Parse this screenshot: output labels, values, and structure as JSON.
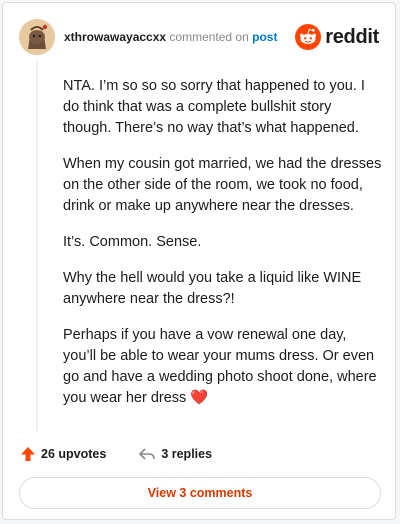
{
  "header": {
    "username": "xthrowawayaccxx",
    "commented_on": "commented on",
    "post_label": "post",
    "logo_text": "reddit"
  },
  "comment": {
    "paragraphs": [
      "NTA. I’m so so so sorry that happened to you. I do think that was a complete bullshit story though. There’s no way that’s what happened.",
      "When my cousin got married, we had the dresses on the other side of the room, we took no food, drink or make up anywhere near the dresses.",
      "It’s. Common. Sense.",
      "Why the hell would you take a liquid like WINE anywhere near the dress?!",
      "Perhaps if you have a vow renewal one day, you’ll be able to wear your mums dress. Or even go and have a wedding photo shoot done, where you wear her dress"
    ],
    "emoji": "❤️"
  },
  "actions": {
    "upvotes": "26 upvotes",
    "replies": "3 replies"
  },
  "view_comments": "View 3 comments",
  "icons": {
    "upvote": "upvote-arrow-icon",
    "reply": "reply-arrow-icon",
    "logo": "reddit-snoo-icon"
  },
  "colors": {
    "accent": "#ff4500",
    "link": "#0079d3",
    "view_button_text": "#d93a00"
  }
}
